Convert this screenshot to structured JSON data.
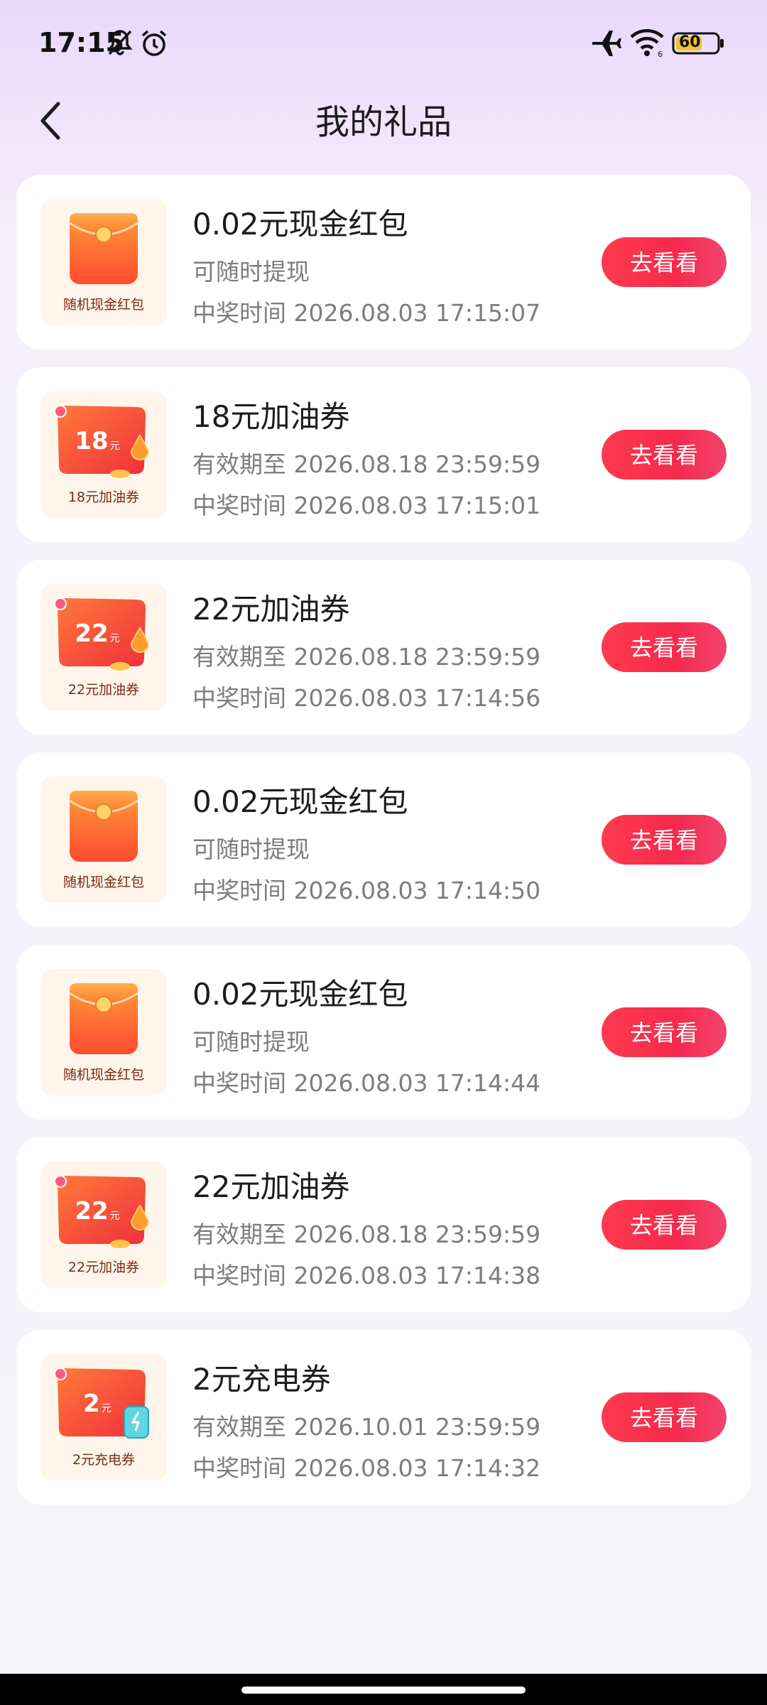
{
  "status_bar": {
    "time": "17:15",
    "battery": "60"
  },
  "header": {
    "title": "我的礼品"
  },
  "gifts": [
    {
      "name": "0.02元现金红包",
      "sub": "可随时提现",
      "time": "中奖时间 2026.08.03 17:15:07",
      "thumb_label": "随机现金红包",
      "thumb_type": "red-envelope",
      "button": "去看看"
    },
    {
      "name": "18元加油券",
      "sub": "有效期至 2026.08.18 23:59:59",
      "time": "中奖时间 2026.08.03 17:15:01",
      "thumb_label": "18元加油券",
      "thumb_type": "fuel-coupon",
      "thumb_value": "18",
      "thumb_unit": "元",
      "button": "去看看"
    },
    {
      "name": "22元加油券",
      "sub": "有效期至 2026.08.18 23:59:59",
      "time": "中奖时间 2026.08.03 17:14:56",
      "thumb_label": "22元加油券",
      "thumb_type": "fuel-coupon",
      "thumb_value": "22",
      "thumb_unit": "元",
      "button": "去看看"
    },
    {
      "name": "0.02元现金红包",
      "sub": "可随时提现",
      "time": "中奖时间 2026.08.03 17:14:50",
      "thumb_label": "随机现金红包",
      "thumb_type": "red-envelope",
      "button": "去看看"
    },
    {
      "name": "0.02元现金红包",
      "sub": "可随时提现",
      "time": "中奖时间 2026.08.03 17:14:44",
      "thumb_label": "随机现金红包",
      "thumb_type": "red-envelope",
      "button": "去看看"
    },
    {
      "name": "22元加油券",
      "sub": "有效期至 2026.08.18 23:59:59",
      "time": "中奖时间 2026.08.03 17:14:38",
      "thumb_label": "22元加油券",
      "thumb_type": "fuel-coupon",
      "thumb_value": "22",
      "thumb_unit": "元",
      "button": "去看看"
    },
    {
      "name": "2元充电券",
      "sub": "有效期至 2026.10.01 23:59:59",
      "time": "中奖时间 2026.08.03 17:14:32",
      "thumb_label": "2元充电券",
      "thumb_type": "charge-coupon",
      "thumb_value": "2",
      "thumb_unit": "元",
      "button": "去看看"
    }
  ],
  "colors": {
    "accent": "#f52a4c",
    "header_bg": "#ead8fb",
    "page_bg": "#f4f4f9"
  }
}
